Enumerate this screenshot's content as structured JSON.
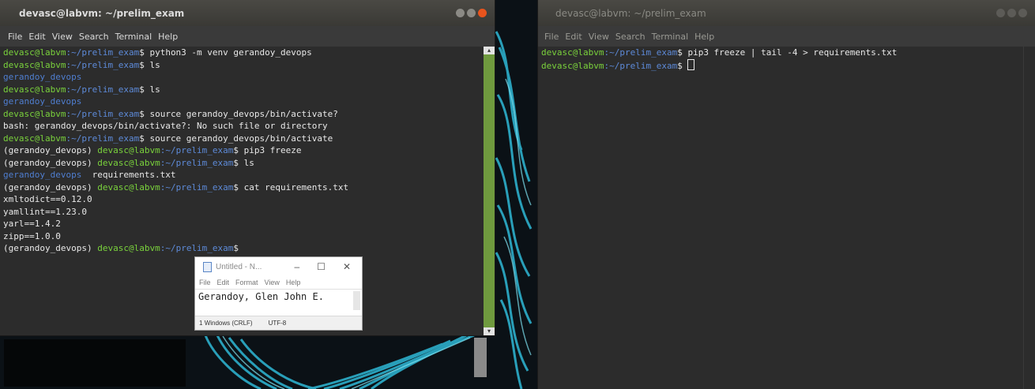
{
  "left_terminal": {
    "title": "devasc@labvm: ~/prelim_exam",
    "menu": [
      "File",
      "Edit",
      "View",
      "Search",
      "Terminal",
      "Help"
    ],
    "lines": [
      [
        {
          "t": "devasc@labvm",
          "c": "prompt"
        },
        {
          "t": ":~/prelim_exam",
          "c": "path"
        },
        {
          "t": "$ python3 -m venv gerandoy_devops",
          "c": "text"
        }
      ],
      [
        {
          "t": "devasc@labvm",
          "c": "prompt"
        },
        {
          "t": ":~/prelim_exam",
          "c": "path"
        },
        {
          "t": "$ ls",
          "c": "text"
        }
      ],
      [
        {
          "t": "gerandoy_devops",
          "c": "folder"
        }
      ],
      [
        {
          "t": "devasc@labvm",
          "c": "prompt"
        },
        {
          "t": ":~/prelim_exam",
          "c": "path"
        },
        {
          "t": "$ ls",
          "c": "text"
        }
      ],
      [
        {
          "t": "gerandoy_devops",
          "c": "folder"
        }
      ],
      [
        {
          "t": "devasc@labvm",
          "c": "prompt"
        },
        {
          "t": ":~/prelim_exam",
          "c": "path"
        },
        {
          "t": "$ source gerandoy_devops/bin/activate?",
          "c": "text"
        }
      ],
      [
        {
          "t": "bash: gerandoy_devops/bin/activate?: No such file or directory",
          "c": "text"
        }
      ],
      [
        {
          "t": "devasc@labvm",
          "c": "prompt"
        },
        {
          "t": ":~/prelim_exam",
          "c": "path"
        },
        {
          "t": "$ source gerandoy_devops/bin/activate",
          "c": "text"
        }
      ],
      [
        {
          "t": "(gerandoy_devops) ",
          "c": "text"
        },
        {
          "t": "devasc@labvm",
          "c": "prompt"
        },
        {
          "t": ":~/prelim_exam",
          "c": "path"
        },
        {
          "t": "$ pip3 freeze",
          "c": "text"
        }
      ],
      [
        {
          "t": "(gerandoy_devops) ",
          "c": "text"
        },
        {
          "t": "devasc@labvm",
          "c": "prompt"
        },
        {
          "t": ":~/prelim_exam",
          "c": "path"
        },
        {
          "t": "$ ls",
          "c": "text"
        }
      ],
      [
        {
          "t": "gerandoy_devops",
          "c": "folder"
        },
        {
          "t": "  requirements.txt",
          "c": "text"
        }
      ],
      [
        {
          "t": "(gerandoy_devops) ",
          "c": "text"
        },
        {
          "t": "devasc@labvm",
          "c": "prompt"
        },
        {
          "t": ":~/prelim_exam",
          "c": "path"
        },
        {
          "t": "$ cat requirements.txt",
          "c": "text"
        }
      ],
      [
        {
          "t": "xmltodict==0.12.0",
          "c": "text"
        }
      ],
      [
        {
          "t": "yamllint==1.23.0",
          "c": "text"
        }
      ],
      [
        {
          "t": "yarl==1.4.2",
          "c": "text"
        }
      ],
      [
        {
          "t": "zipp==1.0.0",
          "c": "text"
        }
      ],
      [
        {
          "t": "(gerandoy_devops) ",
          "c": "text"
        },
        {
          "t": "devasc@labvm",
          "c": "prompt"
        },
        {
          "t": ":~/prelim_exam",
          "c": "path"
        },
        {
          "t": "$",
          "c": "text"
        }
      ]
    ]
  },
  "right_terminal": {
    "title": "devasc@labvm: ~/prelim_exam",
    "menu": [
      "File",
      "Edit",
      "View",
      "Search",
      "Terminal",
      "Help"
    ],
    "lines": [
      [
        {
          "t": "devasc@labvm",
          "c": "prompt"
        },
        {
          "t": ":~/prelim_exam",
          "c": "path"
        },
        {
          "t": "$ pip3 freeze | tail -4 > requirements.txt",
          "c": "text"
        }
      ],
      [
        {
          "t": "devasc@labvm",
          "c": "prompt"
        },
        {
          "t": ":~/prelim_exam",
          "c": "path"
        },
        {
          "t": "$ ",
          "c": "text"
        },
        {
          "t": "",
          "c": "cursor"
        }
      ]
    ]
  },
  "notepad": {
    "title": "Untitled - N...",
    "menu": [
      "File",
      "Edit",
      "Format",
      "View",
      "Help"
    ],
    "content": "Gerandoy, Glen John E.",
    "status_line_ending": "Windows (CRLF)",
    "status_encoding": "UTF-8",
    "status_prefix": "1"
  },
  "icons": {
    "minimize": "minimize-icon",
    "maximize": "maximize-icon",
    "close": "close-icon"
  }
}
